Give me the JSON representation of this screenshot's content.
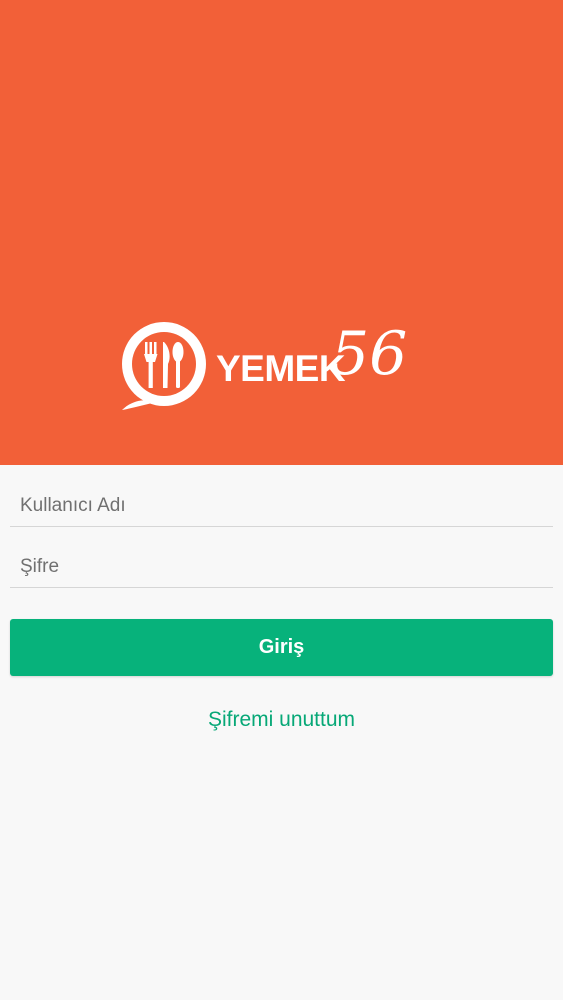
{
  "brand": {
    "name": "YEMEK",
    "script_number": "56",
    "header_color": "#f26038"
  },
  "login": {
    "username_placeholder": "Kullanıcı Adı",
    "password_placeholder": "Şifre",
    "submit_label": "Giriş",
    "submit_color": "#07b27b",
    "forgot_label": "Şifremi unuttum"
  },
  "icons": {
    "logo": "plate-fork-knife-spoon-icon"
  }
}
